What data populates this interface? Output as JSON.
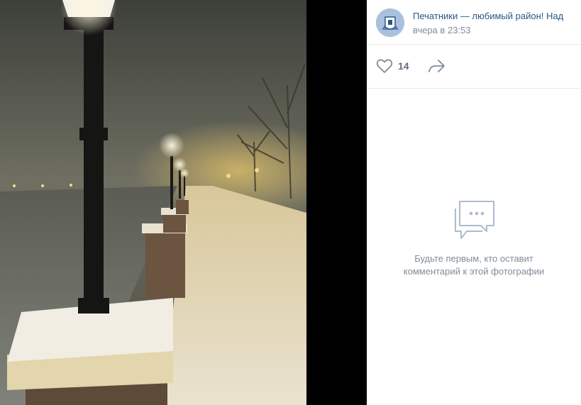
{
  "photo": {
    "icon": "photo-night-embankment"
  },
  "post": {
    "group_name": "Печатники — любимый район! Над",
    "time": "вчера в 23:53",
    "avatar_icon": "group-emblem-icon"
  },
  "actions": {
    "like_icon": "heart-icon",
    "like_count": "14",
    "share_icon": "share-arrow-icon"
  },
  "comments": {
    "empty_icon": "comments-icon",
    "empty_line1": "Будьте первым, кто оставит",
    "empty_line2": "комментарий к этой фотографии"
  },
  "colors": {
    "link": "#2a5885",
    "muted": "#818c99",
    "divider": "#e7e8ec"
  }
}
